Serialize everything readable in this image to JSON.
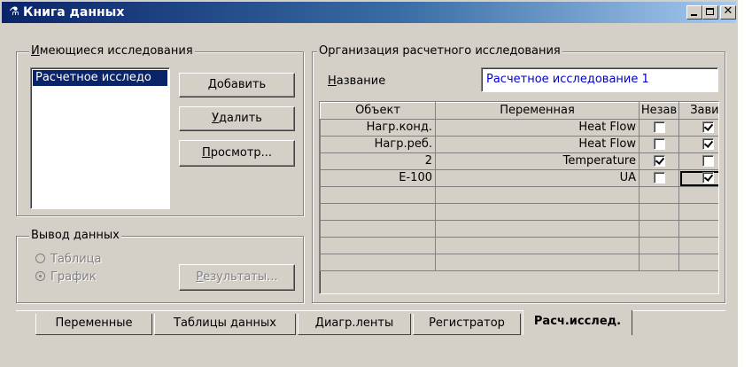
{
  "window": {
    "title": "Книга данных",
    "icon": "flask-icon",
    "controls": [
      "minimize",
      "maximize",
      "close"
    ]
  },
  "studies_group": {
    "legend": "Имеющиеся исследования",
    "list_items": [
      "Расчетное исследо"
    ],
    "selected_index": 0,
    "add_button": "Добавить",
    "delete_button": "Удалить",
    "view_button": "Просмотр..."
  },
  "output_group": {
    "legend": "Вывод данных",
    "radio_table": "Таблица",
    "radio_graph": "График",
    "selected": "График",
    "results_button": "Результаты..."
  },
  "organization_group": {
    "legend": "Организация расчетного исследования",
    "name_label": "Название",
    "name_value": "Расчетное исследование 1",
    "columns": [
      "Объект",
      "Переменная",
      "Незав",
      "Завис"
    ],
    "rows": [
      {
        "object": "Нагр.конд.",
        "variable": "Heat Flow",
        "independent": false,
        "dependent": true
      },
      {
        "object": "Нагр.реб.",
        "variable": "Heat Flow",
        "independent": false,
        "dependent": true
      },
      {
        "object": "2",
        "variable": "Temperature",
        "independent": true,
        "dependent": false
      },
      {
        "object": "E-100",
        "variable": "UA",
        "independent": false,
        "dependent": true
      }
    ],
    "empty_rows": 5
  },
  "tabs": [
    {
      "label": "Переменные",
      "active": false
    },
    {
      "label": "Таблицы данных",
      "active": false
    },
    {
      "label": "Диагр.ленты",
      "active": false
    },
    {
      "label": "Регистратор",
      "active": false
    },
    {
      "label": "Расч.исслед.",
      "active": true
    }
  ],
  "colors": {
    "titlebar_start": "#0a246a",
    "titlebar_end": "#a6caf0",
    "list_selection": "#0a246a",
    "name_text": "#0000cc",
    "face": "#d4d0c8"
  }
}
